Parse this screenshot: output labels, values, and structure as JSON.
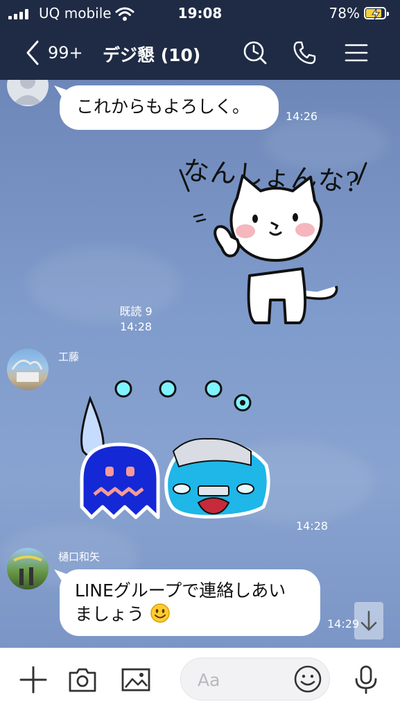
{
  "status_bar": {
    "carrier": "UQ mobile",
    "time": "19:08",
    "battery_percent": "78%",
    "battery_level": 0.78,
    "battery_charging": true
  },
  "header": {
    "unread_count": "99+",
    "title": "デジ懇 (10)",
    "icons": [
      "back-chevron-icon",
      "history-clock-icon",
      "phone-icon",
      "menu-icon"
    ]
  },
  "messages": [
    {
      "type": "text",
      "side": "left",
      "sender": "",
      "text": "これからもよろしく。",
      "time": "14:26"
    },
    {
      "type": "sticker",
      "side": "right",
      "sticker_text": "なんしょんな?",
      "read": "既読 9",
      "time": "14:28"
    },
    {
      "type": "sticker",
      "side": "left",
      "sender": "工藤",
      "time": "14:28"
    },
    {
      "type": "text",
      "side": "left",
      "sender": "樋口和矢",
      "lines": [
        "LINEグループで連絡しあい",
        "ましょう"
      ],
      "time": "14:29"
    }
  ],
  "input_bar": {
    "placeholder": "Aa",
    "icons": [
      "plus-icon",
      "camera-icon",
      "image-icon",
      "emoji-icon",
      "microphone-icon"
    ]
  },
  "colors": {
    "header_bg": "#1f2b45",
    "chat_bg": "#7d97c4",
    "bubble_bg": "#ffffff",
    "battery_fill": "#f4d03f"
  }
}
